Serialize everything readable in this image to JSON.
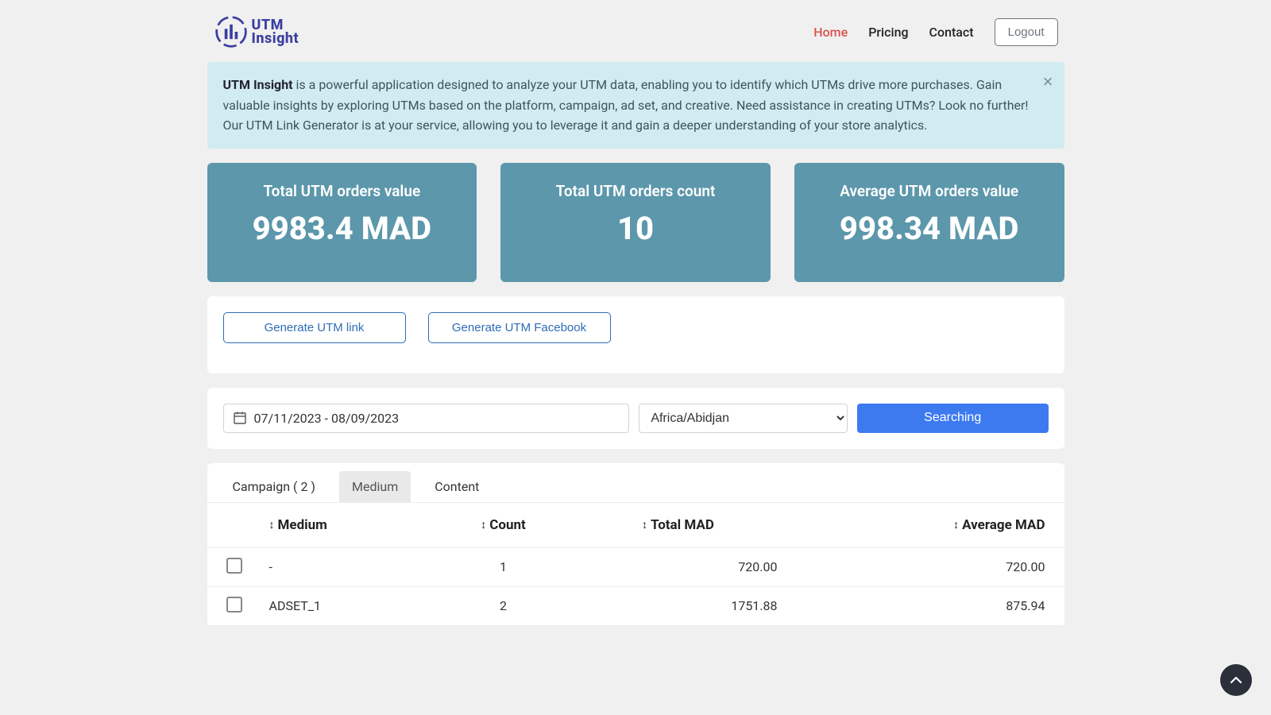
{
  "brand": {
    "line1": "UTM",
    "line2": "Insight"
  },
  "nav": {
    "home": "Home",
    "pricing": "Pricing",
    "contact": "Contact",
    "logout": "Logout"
  },
  "alert": {
    "strong": "UTM Insight",
    "body": " is a powerful application designed to analyze your UTM data, enabling you to identify which UTMs drive more purchases. Gain valuable insights by exploring UTMs based on the platform, campaign, ad set, and creative. Need assistance in creating UTMs? Look no further! Our UTM Link Generator is at your service, allowing you to leverage it and gain a deeper understanding of your store analytics."
  },
  "metrics": [
    {
      "title": "Total UTM orders value",
      "value": "9983.4 MAD"
    },
    {
      "title": "Total UTM orders count",
      "value": "10"
    },
    {
      "title": "Average UTM orders value",
      "value": "998.34 MAD"
    }
  ],
  "generators": {
    "link": "Generate UTM link",
    "facebook": "Generate UTM Facebook"
  },
  "search": {
    "date_range": "07/11/2023 - 08/09/2023",
    "timezone": "Africa/Abidjan",
    "button": "Searching"
  },
  "tabs": {
    "campaign": "Campaign ( 2 )",
    "medium": "Medium",
    "content": "Content"
  },
  "table": {
    "headers": {
      "medium": "Medium",
      "count": "Count",
      "total": "Total MAD",
      "average": "Average MAD"
    },
    "rows": [
      {
        "medium": "-",
        "count": "1",
        "total": "720.00",
        "average": "720.00"
      },
      {
        "medium": "ADSET_1",
        "count": "2",
        "total": "1751.88",
        "average": "875.94"
      }
    ]
  }
}
